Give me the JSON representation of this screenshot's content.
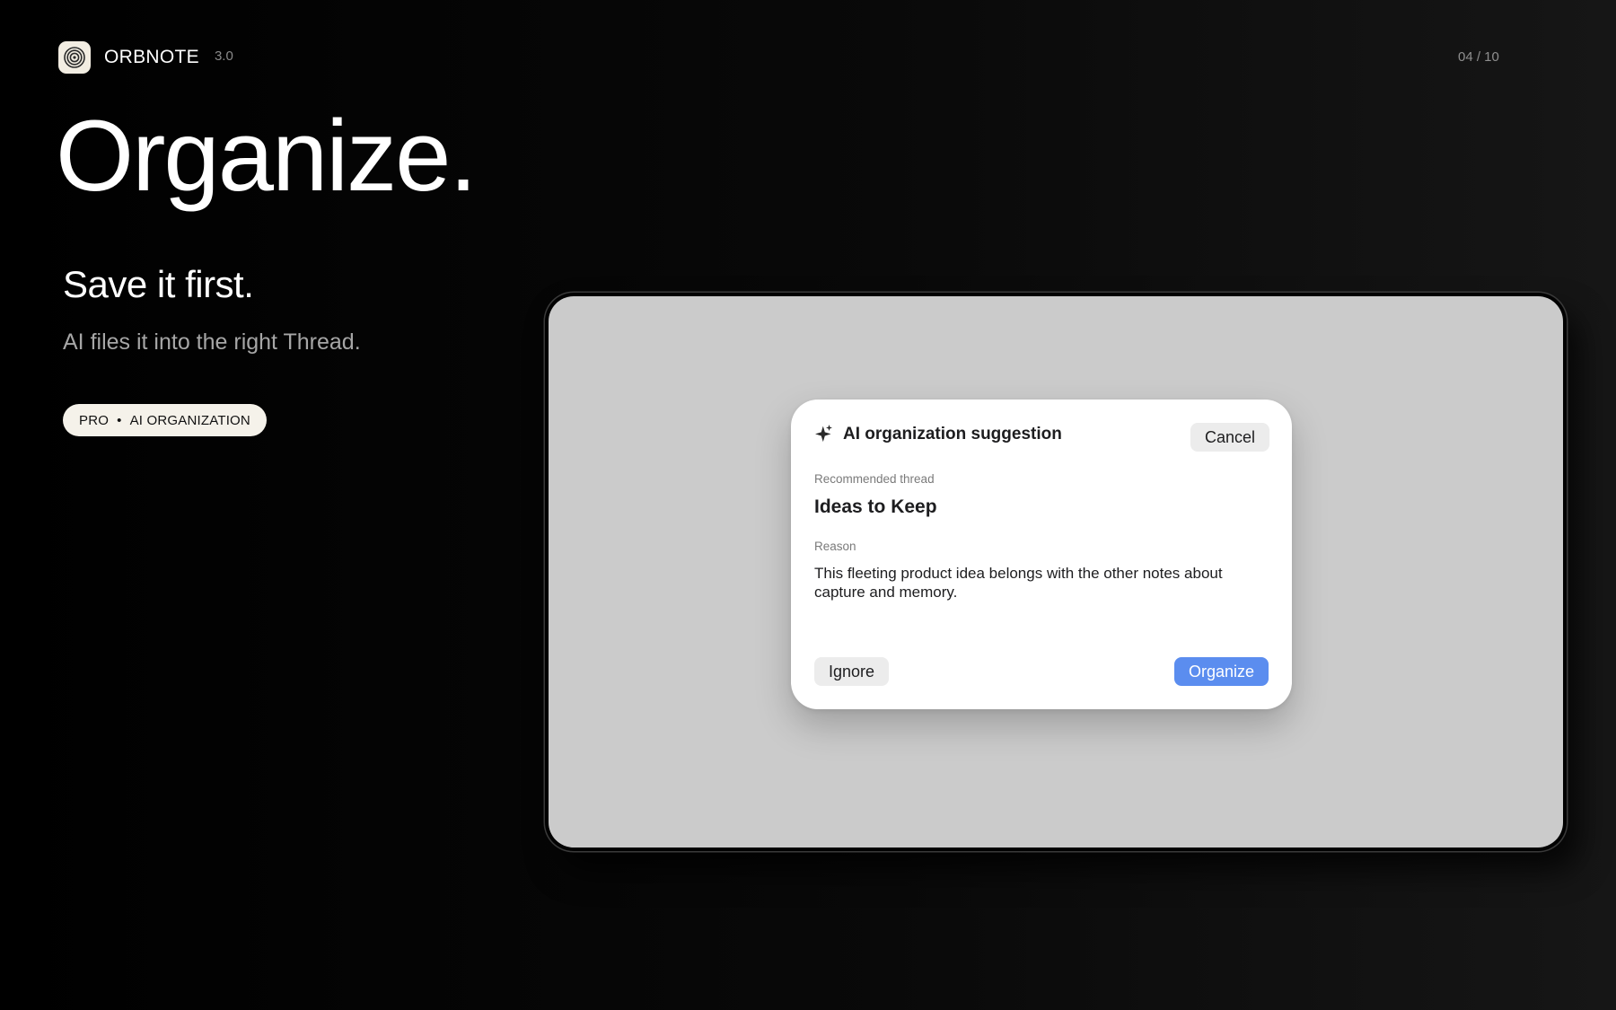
{
  "brand": {
    "name": "ORBNOTE",
    "version": "3.0"
  },
  "pagination": {
    "current": "04 / 10"
  },
  "hero": {
    "title": "Organize.",
    "subtitle": "Save it first.",
    "tagline": "AI files it into the right Thread."
  },
  "pill": {
    "plan": "PRO",
    "separator": "•",
    "feature": "AI ORGANIZATION"
  },
  "dialog": {
    "icon": "sparkle-icon",
    "title": "AI organization suggestion",
    "cancel_label": "Cancel",
    "recommended_label": "Recommended thread",
    "thread_name": "Ideas to Keep",
    "reason_label": "Reason",
    "reason_text": "This fleeting product idea belongs with the other notes about capture and memory.",
    "ignore_label": "Ignore",
    "organize_label": "Organize"
  },
  "colors": {
    "accent": "#5b8def",
    "pill_background": "#f5f2ea",
    "screen_background": "#cbcbcb",
    "page_background": "#000000"
  }
}
